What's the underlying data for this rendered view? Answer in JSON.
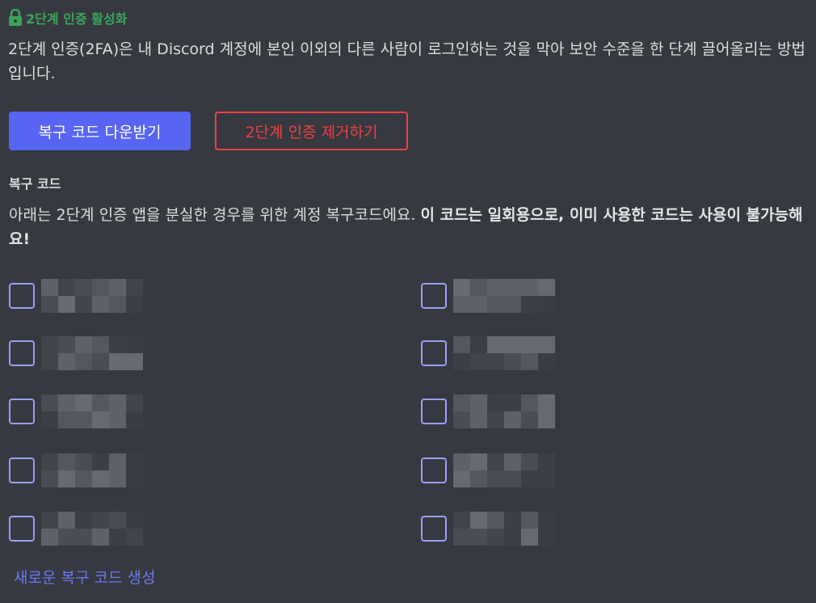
{
  "header": {
    "icon": "lock-icon",
    "title": "2단계 인증 활성화",
    "title_color": "#3ba55d"
  },
  "description": "2단계 인증(2FA)은 내 Discord 계정에 본인 이외의 다른 사람이 로그인하는 것을 막아 보안 수준을 한 단계 끌어올리는 방법입니다.",
  "buttons": {
    "download_label": "복구 코드 다운받기",
    "remove_label": "2단계 인증 제거하기"
  },
  "backup": {
    "title": "복구 코드",
    "desc_plain": "아래는 2단계 인증 앱을 분실한 경우를 위한 계정 복구코드에요. ",
    "desc_bold": "이 코드는 일회용으로, 이미 사용한 코드는 사용이 불가능해요!",
    "codes_left_count": 5,
    "codes_right_count": 5,
    "codes_blurred": true
  },
  "link_label": "새로운 복구 코드 생성",
  "colors": {
    "background": "#36393f",
    "primary": "#5865f2",
    "danger": "#ed4245",
    "checkbox_border": "#9a9ff3"
  }
}
